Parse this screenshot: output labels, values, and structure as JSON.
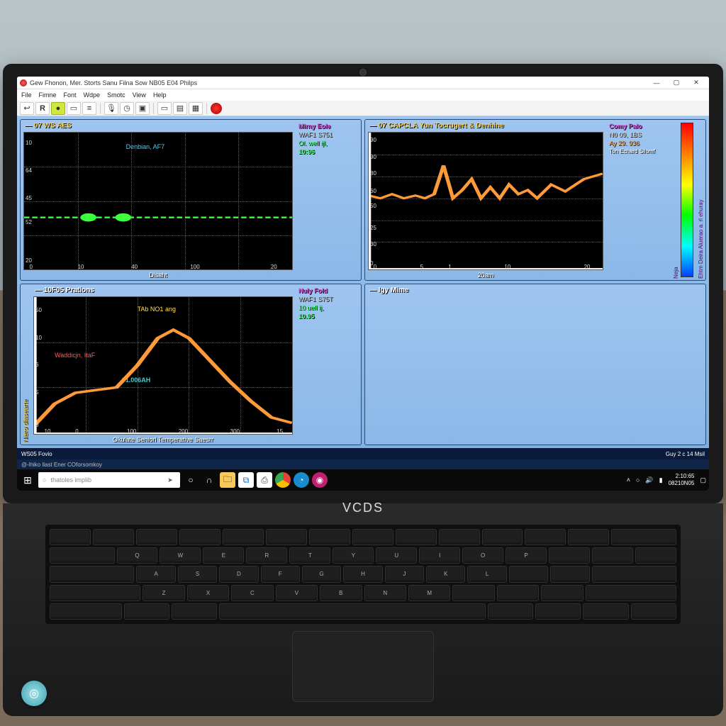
{
  "window": {
    "title": "Gew Fhonon, Mer. Storts Sanu Filna Sow NB05 E04 Philps",
    "menu": [
      "File",
      "Fimne",
      "Font",
      "Wdpe",
      "Smotc",
      "View",
      "Help"
    ],
    "toolbar_icons": [
      "back",
      "bold-R",
      "circle",
      "box",
      "menu",
      "mic",
      "clock",
      "play",
      "sep",
      "screen",
      "sheet",
      "grid",
      "sep",
      "record"
    ]
  },
  "panels": {
    "tl": {
      "title": "07 WS AES",
      "xlabel": "Disaht",
      "annotation": "Denbian, AF7",
      "legend": {
        "lbl": "Mirny Eole",
        "v1": "WAF1 S751",
        "v2": "Ol. well ijl,",
        "v3": "10:96"
      },
      "xticks": [
        "0",
        "10",
        "40",
        "100",
        "20"
      ],
      "yticks": [
        "20",
        "52",
        "45",
        "64",
        "10"
      ]
    },
    "bl": {
      "title": "10F05 Prations",
      "xlabel": "Okulate Seniorl Temperative Saesrr",
      "ylabel": "Niero diasearte",
      "ann_top": "TAb NO1 ang",
      "ann_left": "Waddicjn, ItaF",
      "ann_mid": "01.006AH",
      "legend": {
        "lbl": "Nuly Fold",
        "v1": "WAF1 S75T",
        "v2": "10 uell ij,",
        "v3": "10.95"
      },
      "xticks": [
        "10",
        "0",
        "100",
        "200",
        "300",
        "15"
      ],
      "yticks": [
        "0",
        "5",
        "6",
        "10",
        "50"
      ]
    },
    "tr": {
      "title": "07 CAPCLA  Yun Tocrugert & Denhine",
      "xlabel": "20am",
      "legend": {
        "r1": "Comy Palo",
        "r2": "N0 09, 1BS",
        "r3": "Ay 29. 936",
        "r4": "Ton Echard Silomf"
      },
      "colorbar_label": "Ehtm Deira Aluerao a. rl ehuray",
      "colorbar_top": "Neja",
      "xticks": [
        "0",
        "5",
        "1",
        "10",
        "20"
      ],
      "yticks": [
        "0",
        "30",
        "25",
        "50",
        "60",
        "80",
        "90",
        "90"
      ]
    },
    "br": {
      "title": "Igy Mime"
    }
  },
  "status": {
    "left": "WS05 Fovio",
    "right": "Guy  2 c 14 Msil",
    "line2": "@-lhiko  llast Ener COforsomkoy"
  },
  "taskbar": {
    "search_placeholder": "thatoles implib",
    "clock_time": "2:10:65",
    "clock_date": "08210N05"
  },
  "laptop_logo": "VCDS",
  "chart_data": [
    {
      "panel": "tl",
      "type": "line",
      "title": "07 WS AES",
      "xlabel": "Disaht",
      "xlim": [
        0,
        120
      ],
      "ylim": [
        20,
        100
      ],
      "series": [
        {
          "name": "Denbian AF7",
          "color": "#3aff3a",
          "x": [
            0,
            10,
            20,
            30,
            40,
            50,
            60,
            70,
            80,
            90,
            100,
            110,
            120
          ],
          "y": [
            50,
            50,
            50,
            50,
            50,
            50,
            50,
            50,
            50,
            50,
            50,
            50,
            50
          ]
        }
      ],
      "markers": [
        {
          "x": 28,
          "y": 50
        },
        {
          "x": 44,
          "y": 50
        }
      ]
    },
    {
      "panel": "bl",
      "type": "line",
      "title": "10F05 Prations",
      "xlabel": "Okulate Seniorl Temperative Saesrr",
      "ylabel": "Niero diasearte",
      "xlim": [
        0,
        320
      ],
      "ylim": [
        0,
        50
      ],
      "series": [
        {
          "name": "TAb NO1 ang",
          "color": "#ff9a3a",
          "x": [
            0,
            30,
            60,
            90,
            120,
            150,
            180,
            210,
            240,
            270,
            300,
            320
          ],
          "y": [
            2,
            8,
            10,
            10,
            12,
            22,
            30,
            26,
            18,
            12,
            6,
            3
          ]
        }
      ]
    },
    {
      "panel": "tr",
      "type": "line",
      "title": "07 CAPCLA Yun Tocrugert & Denhine",
      "xlabel": "20am",
      "xlim": [
        0,
        20
      ],
      "ylim": [
        0,
        90
      ],
      "series": [
        {
          "name": "Comy Palo",
          "color": "#ff9a3a",
          "x": [
            0,
            1,
            2,
            3,
            4,
            5,
            6,
            7,
            8,
            9,
            10,
            11,
            12,
            13,
            14,
            15,
            16,
            17,
            18,
            19,
            20
          ],
          "y": [
            52,
            50,
            53,
            50,
            52,
            50,
            53,
            72,
            50,
            56,
            64,
            50,
            58,
            50,
            60,
            53,
            56,
            50,
            60,
            55,
            65
          ]
        }
      ]
    }
  ]
}
